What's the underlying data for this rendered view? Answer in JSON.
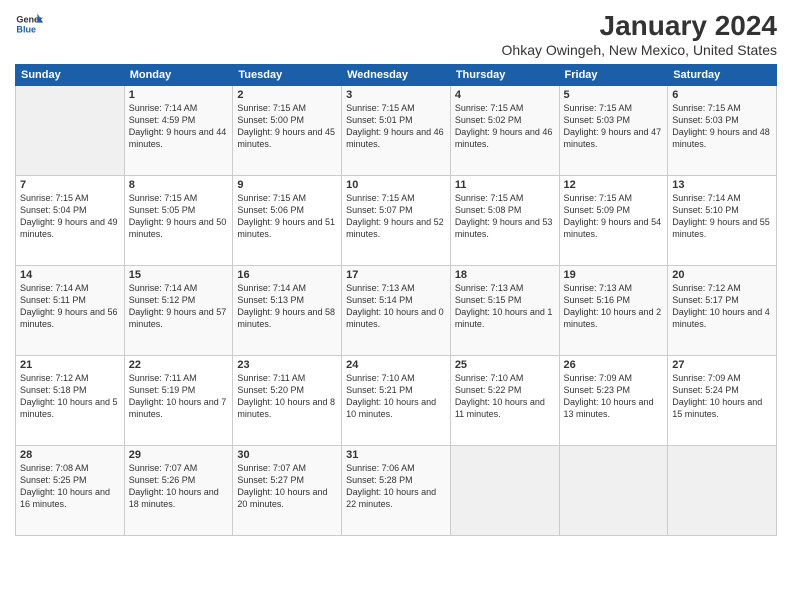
{
  "logo": {
    "general": "General",
    "blue": "Blue"
  },
  "header": {
    "title": "January 2024",
    "subtitle": "Ohkay Owingeh, New Mexico, United States"
  },
  "weekdays": [
    "Sunday",
    "Monday",
    "Tuesday",
    "Wednesday",
    "Thursday",
    "Friday",
    "Saturday"
  ],
  "weeks": [
    [
      {
        "day": "",
        "empty": true
      },
      {
        "day": "1",
        "sunrise": "Sunrise: 7:14 AM",
        "sunset": "Sunset: 4:59 PM",
        "daylight": "Daylight: 9 hours and 44 minutes."
      },
      {
        "day": "2",
        "sunrise": "Sunrise: 7:15 AM",
        "sunset": "Sunset: 5:00 PM",
        "daylight": "Daylight: 9 hours and 45 minutes."
      },
      {
        "day": "3",
        "sunrise": "Sunrise: 7:15 AM",
        "sunset": "Sunset: 5:01 PM",
        "daylight": "Daylight: 9 hours and 46 minutes."
      },
      {
        "day": "4",
        "sunrise": "Sunrise: 7:15 AM",
        "sunset": "Sunset: 5:02 PM",
        "daylight": "Daylight: 9 hours and 46 minutes."
      },
      {
        "day": "5",
        "sunrise": "Sunrise: 7:15 AM",
        "sunset": "Sunset: 5:03 PM",
        "daylight": "Daylight: 9 hours and 47 minutes."
      },
      {
        "day": "6",
        "sunrise": "Sunrise: 7:15 AM",
        "sunset": "Sunset: 5:03 PM",
        "daylight": "Daylight: 9 hours and 48 minutes."
      }
    ],
    [
      {
        "day": "7",
        "sunrise": "Sunrise: 7:15 AM",
        "sunset": "Sunset: 5:04 PM",
        "daylight": "Daylight: 9 hours and 49 minutes."
      },
      {
        "day": "8",
        "sunrise": "Sunrise: 7:15 AM",
        "sunset": "Sunset: 5:05 PM",
        "daylight": "Daylight: 9 hours and 50 minutes."
      },
      {
        "day": "9",
        "sunrise": "Sunrise: 7:15 AM",
        "sunset": "Sunset: 5:06 PM",
        "daylight": "Daylight: 9 hours and 51 minutes."
      },
      {
        "day": "10",
        "sunrise": "Sunrise: 7:15 AM",
        "sunset": "Sunset: 5:07 PM",
        "daylight": "Daylight: 9 hours and 52 minutes."
      },
      {
        "day": "11",
        "sunrise": "Sunrise: 7:15 AM",
        "sunset": "Sunset: 5:08 PM",
        "daylight": "Daylight: 9 hours and 53 minutes."
      },
      {
        "day": "12",
        "sunrise": "Sunrise: 7:15 AM",
        "sunset": "Sunset: 5:09 PM",
        "daylight": "Daylight: 9 hours and 54 minutes."
      },
      {
        "day": "13",
        "sunrise": "Sunrise: 7:14 AM",
        "sunset": "Sunset: 5:10 PM",
        "daylight": "Daylight: 9 hours and 55 minutes."
      }
    ],
    [
      {
        "day": "14",
        "sunrise": "Sunrise: 7:14 AM",
        "sunset": "Sunset: 5:11 PM",
        "daylight": "Daylight: 9 hours and 56 minutes."
      },
      {
        "day": "15",
        "sunrise": "Sunrise: 7:14 AM",
        "sunset": "Sunset: 5:12 PM",
        "daylight": "Daylight: 9 hours and 57 minutes."
      },
      {
        "day": "16",
        "sunrise": "Sunrise: 7:14 AM",
        "sunset": "Sunset: 5:13 PM",
        "daylight": "Daylight: 9 hours and 58 minutes."
      },
      {
        "day": "17",
        "sunrise": "Sunrise: 7:13 AM",
        "sunset": "Sunset: 5:14 PM",
        "daylight": "Daylight: 10 hours and 0 minutes."
      },
      {
        "day": "18",
        "sunrise": "Sunrise: 7:13 AM",
        "sunset": "Sunset: 5:15 PM",
        "daylight": "Daylight: 10 hours and 1 minute."
      },
      {
        "day": "19",
        "sunrise": "Sunrise: 7:13 AM",
        "sunset": "Sunset: 5:16 PM",
        "daylight": "Daylight: 10 hours and 2 minutes."
      },
      {
        "day": "20",
        "sunrise": "Sunrise: 7:12 AM",
        "sunset": "Sunset: 5:17 PM",
        "daylight": "Daylight: 10 hours and 4 minutes."
      }
    ],
    [
      {
        "day": "21",
        "sunrise": "Sunrise: 7:12 AM",
        "sunset": "Sunset: 5:18 PM",
        "daylight": "Daylight: 10 hours and 5 minutes."
      },
      {
        "day": "22",
        "sunrise": "Sunrise: 7:11 AM",
        "sunset": "Sunset: 5:19 PM",
        "daylight": "Daylight: 10 hours and 7 minutes."
      },
      {
        "day": "23",
        "sunrise": "Sunrise: 7:11 AM",
        "sunset": "Sunset: 5:20 PM",
        "daylight": "Daylight: 10 hours and 8 minutes."
      },
      {
        "day": "24",
        "sunrise": "Sunrise: 7:10 AM",
        "sunset": "Sunset: 5:21 PM",
        "daylight": "Daylight: 10 hours and 10 minutes."
      },
      {
        "day": "25",
        "sunrise": "Sunrise: 7:10 AM",
        "sunset": "Sunset: 5:22 PM",
        "daylight": "Daylight: 10 hours and 11 minutes."
      },
      {
        "day": "26",
        "sunrise": "Sunrise: 7:09 AM",
        "sunset": "Sunset: 5:23 PM",
        "daylight": "Daylight: 10 hours and 13 minutes."
      },
      {
        "day": "27",
        "sunrise": "Sunrise: 7:09 AM",
        "sunset": "Sunset: 5:24 PM",
        "daylight": "Daylight: 10 hours and 15 minutes."
      }
    ],
    [
      {
        "day": "28",
        "sunrise": "Sunrise: 7:08 AM",
        "sunset": "Sunset: 5:25 PM",
        "daylight": "Daylight: 10 hours and 16 minutes."
      },
      {
        "day": "29",
        "sunrise": "Sunrise: 7:07 AM",
        "sunset": "Sunset: 5:26 PM",
        "daylight": "Daylight: 10 hours and 18 minutes."
      },
      {
        "day": "30",
        "sunrise": "Sunrise: 7:07 AM",
        "sunset": "Sunset: 5:27 PM",
        "daylight": "Daylight: 10 hours and 20 minutes."
      },
      {
        "day": "31",
        "sunrise": "Sunrise: 7:06 AM",
        "sunset": "Sunset: 5:28 PM",
        "daylight": "Daylight: 10 hours and 22 minutes."
      },
      {
        "day": "",
        "empty": true
      },
      {
        "day": "",
        "empty": true
      },
      {
        "day": "",
        "empty": true
      }
    ]
  ]
}
